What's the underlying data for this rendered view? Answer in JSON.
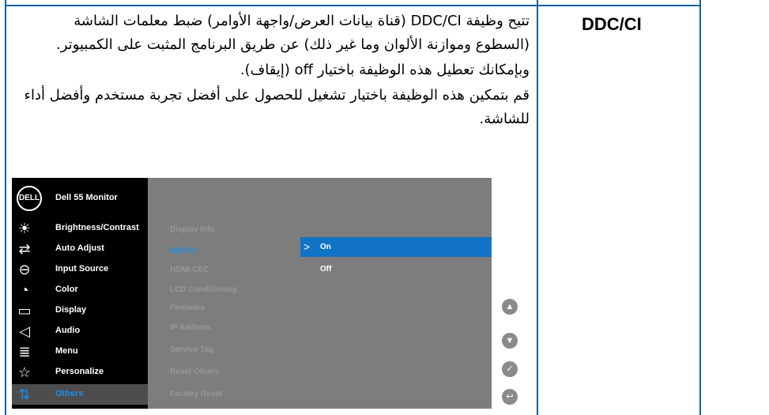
{
  "term": "DDC/CI",
  "description": [
    "تتيح وظيفة DDC/CI (قناة بيانات العرض/واجهة الأوامر) ضبط معلمات الشاشة (السطوع وموازنة الألوان وما غير ذلك) عن طريق البرنامج المثبت على الكمبيوتر.",
    "وبإمكانك تعطيل هذه الوظيفة باختيار off (إيقاف).",
    "قم بتمكين هذه الوظيفة باختيار تشغيل للحصول على أفضل تجربة مستخدم وأفضل أداء للشاشة."
  ],
  "osd": {
    "logo": "DELL",
    "model": "Dell 55 Monitor",
    "menu": [
      {
        "label": "Brightness/Contrast",
        "icon": "sun-icon",
        "glyph": "☀"
      },
      {
        "label": "Auto Adjust",
        "icon": "auto-adjust-icon",
        "glyph": "⇄"
      },
      {
        "label": "Input Source",
        "icon": "input-source-icon",
        "glyph": "⊖"
      },
      {
        "label": "Color",
        "icon": "color-icon",
        "glyph": "◔"
      },
      {
        "label": "Display",
        "icon": "display-icon",
        "glyph": "▭"
      },
      {
        "label": "Audio",
        "icon": "speaker-icon",
        "glyph": "◁"
      },
      {
        "label": "Menu",
        "icon": "menu-icon",
        "glyph": "≣"
      },
      {
        "label": "Personalize",
        "icon": "star-icon",
        "glyph": "☆"
      },
      {
        "label": "Others",
        "icon": "others-icon",
        "glyph": "⇅"
      }
    ],
    "submenu": [
      "Display Info",
      "DDC/CI",
      "HDMI CEC",
      "LCD Conditioning",
      "Firmware",
      "IP Address",
      "Service Tag",
      "Reset Others",
      "Factory Reset"
    ],
    "options": [
      "On",
      "Off"
    ],
    "selected_option": "On",
    "nav_buttons": [
      {
        "name": "up-button",
        "icon": "chevron-up-icon",
        "glyph": "▲"
      },
      {
        "name": "down-button",
        "icon": "chevron-down-icon",
        "glyph": "▼"
      },
      {
        "name": "confirm-button",
        "icon": "check-icon",
        "glyph": "✓"
      },
      {
        "name": "back-button",
        "icon": "back-icon",
        "glyph": "↩"
      }
    ],
    "accent_color": "#1a8fe6",
    "selection_color": "#1173c5"
  }
}
